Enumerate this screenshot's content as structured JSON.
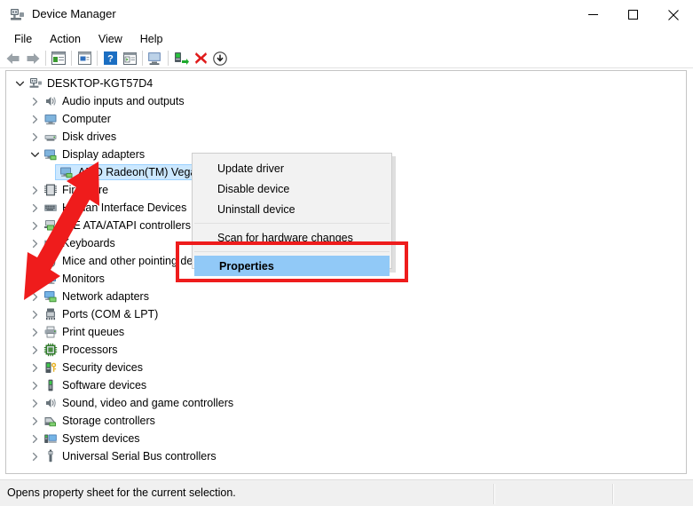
{
  "window": {
    "title": "Device Manager",
    "app_icon": "device-manager-icon",
    "controls": {
      "minimize": "–",
      "maximize": "□",
      "close": "✕"
    }
  },
  "menubar": {
    "items": [
      "File",
      "Action",
      "View",
      "Help"
    ]
  },
  "toolbar": {
    "buttons": [
      {
        "name": "back-icon",
        "glyph": "back"
      },
      {
        "name": "forward-icon",
        "glyph": "forward"
      },
      {
        "name": "sep",
        "glyph": "sep"
      },
      {
        "name": "show-hide-console-tree-icon",
        "glyph": "tree"
      },
      {
        "name": "sep",
        "glyph": "sep"
      },
      {
        "name": "properties-icon",
        "glyph": "props"
      },
      {
        "name": "sep",
        "glyph": "sep"
      },
      {
        "name": "help-icon",
        "glyph": "help"
      },
      {
        "name": "view-icon",
        "glyph": "view"
      },
      {
        "name": "sep",
        "glyph": "sep"
      },
      {
        "name": "scan-hardware-changes-icon",
        "glyph": "scan"
      },
      {
        "name": "sep",
        "glyph": "sep"
      },
      {
        "name": "update-driver-icon",
        "glyph": "update"
      },
      {
        "name": "uninstall-device-icon",
        "glyph": "uninstall"
      },
      {
        "name": "disable-device-icon",
        "glyph": "disable"
      }
    ]
  },
  "tree": {
    "root": {
      "label": "DESKTOP-KGT57D4",
      "icon": "computer-root-icon",
      "expanded": true,
      "indent": 0
    },
    "nodes": [
      {
        "label": "Audio inputs and outputs",
        "icon": "speaker-icon",
        "indent": 1,
        "expanded": false,
        "selected": false
      },
      {
        "label": "Computer",
        "icon": "monitor-icon",
        "indent": 1,
        "expanded": false,
        "selected": false
      },
      {
        "label": "Disk drives",
        "icon": "disk-icon",
        "indent": 1,
        "expanded": false,
        "selected": false
      },
      {
        "label": "Display adapters",
        "icon": "display-adapter-icon",
        "indent": 1,
        "expanded": true,
        "selected": false
      },
      {
        "label": "AMD Radeon(TM) Vega",
        "icon": "display-adapter-icon",
        "indent": 2,
        "expanded": null,
        "selected": true
      },
      {
        "label": "Firmware",
        "icon": "firmware-icon",
        "indent": 1,
        "expanded": false,
        "selected": false
      },
      {
        "label": "Human Interface Devices",
        "icon": "hid-icon",
        "indent": 1,
        "expanded": false,
        "selected": false
      },
      {
        "label": "IDE ATA/ATAPI controllers",
        "icon": "ide-icon",
        "indent": 1,
        "expanded": false,
        "selected": false
      },
      {
        "label": "Keyboards",
        "icon": "keyboard-icon",
        "indent": 1,
        "expanded": false,
        "selected": false
      },
      {
        "label": "Mice and other pointing devices",
        "icon": "mouse-icon",
        "indent": 1,
        "expanded": false,
        "selected": false
      },
      {
        "label": "Monitors",
        "icon": "monitors-icon",
        "indent": 1,
        "expanded": false,
        "selected": false
      },
      {
        "label": "Network adapters",
        "icon": "network-icon",
        "indent": 1,
        "expanded": false,
        "selected": false
      },
      {
        "label": "Ports (COM & LPT)",
        "icon": "port-icon",
        "indent": 1,
        "expanded": false,
        "selected": false
      },
      {
        "label": "Print queues",
        "icon": "printer-icon",
        "indent": 1,
        "expanded": false,
        "selected": false
      },
      {
        "label": "Processors",
        "icon": "processor-icon",
        "indent": 1,
        "expanded": false,
        "selected": false
      },
      {
        "label": "Security devices",
        "icon": "security-icon",
        "indent": 1,
        "expanded": false,
        "selected": false
      },
      {
        "label": "Software devices",
        "icon": "software-device-icon",
        "indent": 1,
        "expanded": false,
        "selected": false
      },
      {
        "label": "Sound, video and game controllers",
        "icon": "speaker-icon",
        "indent": 1,
        "expanded": false,
        "selected": false
      },
      {
        "label": "Storage controllers",
        "icon": "storage-icon",
        "indent": 1,
        "expanded": false,
        "selected": false
      },
      {
        "label": "System devices",
        "icon": "system-device-icon",
        "indent": 1,
        "expanded": false,
        "selected": false
      },
      {
        "label": "Universal Serial Bus controllers",
        "icon": "usb-icon",
        "indent": 1,
        "expanded": false,
        "selected": false
      }
    ]
  },
  "context_menu": {
    "items": [
      {
        "label": "Update driver",
        "highlighted": false,
        "separator_after": false
      },
      {
        "label": "Disable device",
        "highlighted": false,
        "separator_after": false
      },
      {
        "label": "Uninstall device",
        "highlighted": false,
        "separator_after": true
      },
      {
        "label": "Scan for hardware changes",
        "highlighted": false,
        "separator_after": true
      },
      {
        "label": "Properties",
        "highlighted": true,
        "separator_after": false
      }
    ]
  },
  "annotation": {
    "highlight_color": "#ee1c1c",
    "arrow_color": "#ee1c1c",
    "arrow_target": "AMD Radeon(TM) Vega"
  },
  "statusbar": {
    "text": "Opens property sheet for the current selection."
  },
  "colors": {
    "selection_fill": "#cce8ff",
    "menu_highlight": "#91c9f7",
    "window_bg": "#ffffff",
    "status_bg": "#f0f0f0"
  }
}
